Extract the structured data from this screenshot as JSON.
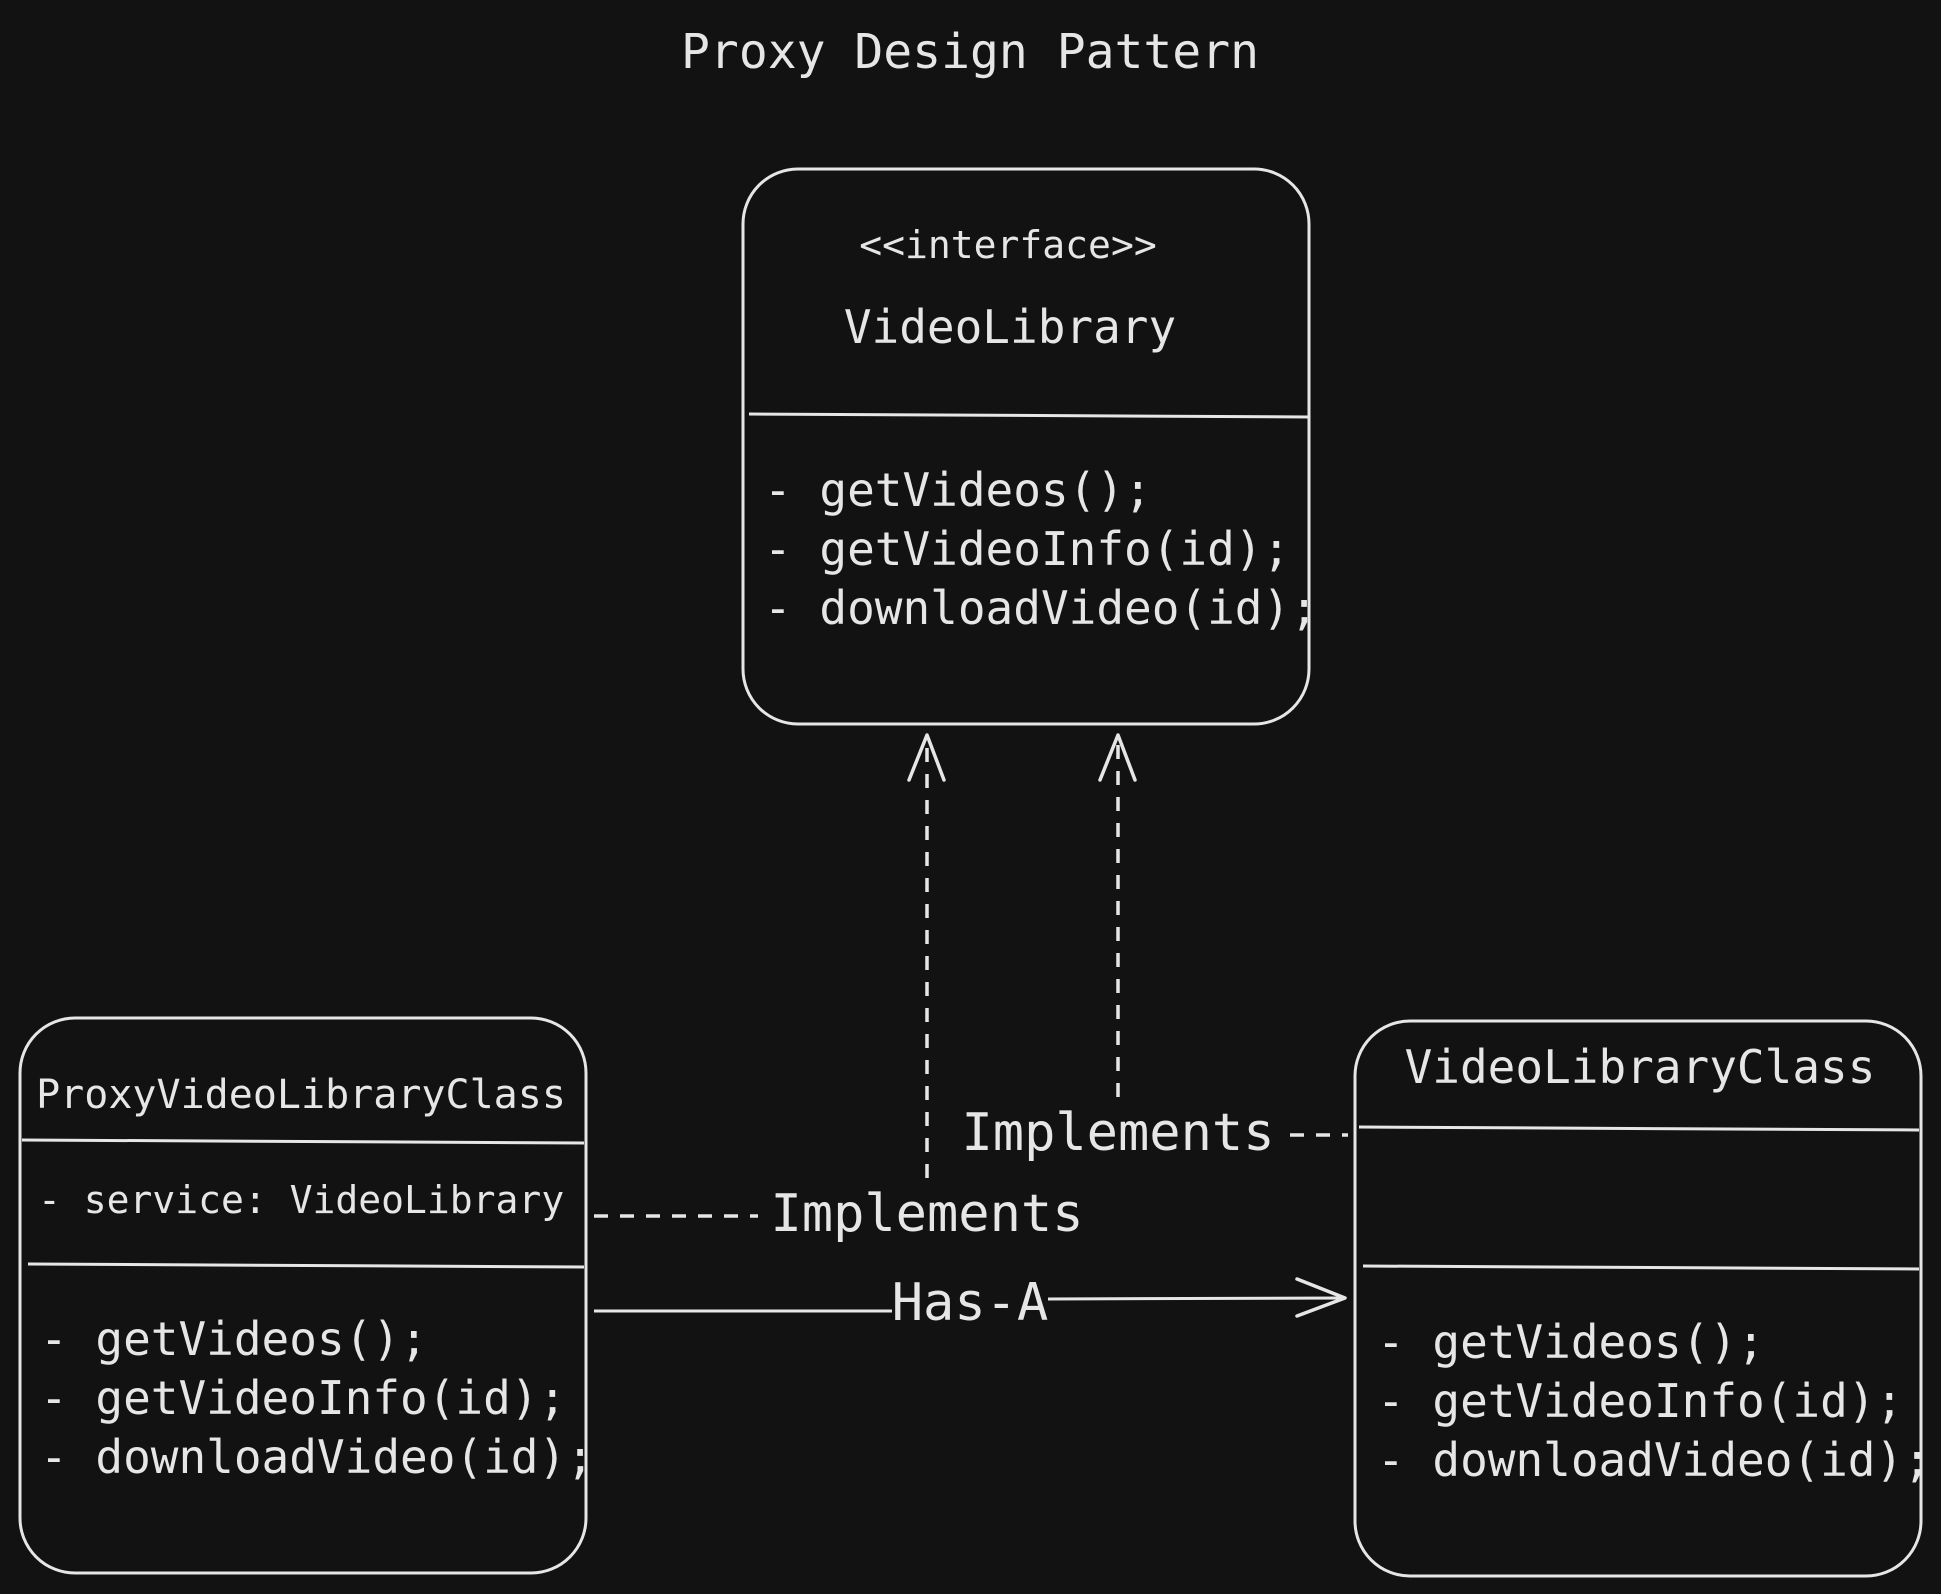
{
  "title": "Proxy Design Pattern",
  "interface_box": {
    "stereotype": "<<interface>>",
    "name": "VideoLibrary",
    "methods": [
      "- getVideos();",
      "- getVideoInfo(id);",
      "- downloadVideo(id);"
    ]
  },
  "proxy_box": {
    "name": "ProxyVideoLibraryClass",
    "attribute": "- service: VideoLibrary",
    "methods": [
      "- getVideos();",
      "- getVideoInfo(id);",
      "- downloadVideo(id);"
    ]
  },
  "real_box": {
    "name": "VideoLibraryClass",
    "methods": [
      "- getVideos();",
      "- getVideoInfo(id);",
      "- downloadVideo(id);"
    ]
  },
  "edges": {
    "proxy_implements": "Implements",
    "real_implements": "Implements",
    "has_a": "Has-A"
  },
  "colors": {
    "background": "#121212",
    "stroke": "#e6e6e6"
  }
}
